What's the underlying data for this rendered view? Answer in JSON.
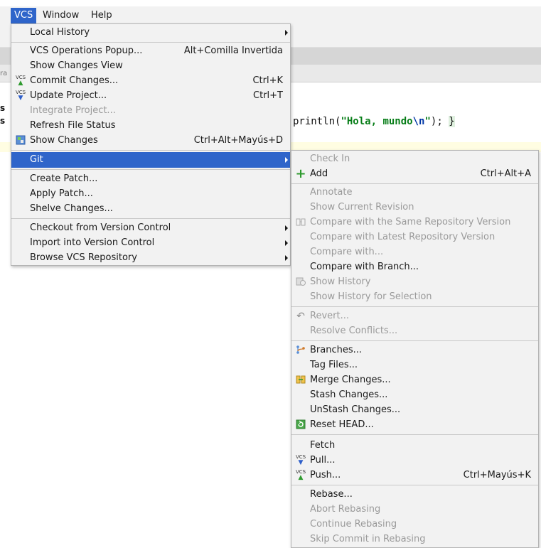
{
  "menubar": {
    "vcs": "VCS",
    "window": "Window",
    "help": "Help"
  },
  "vcs_menu": {
    "local_history": "Local History",
    "vcs_operations_popup": "VCS Operations Popup...",
    "vcs_operations_popup_shortcut": "Alt+Comilla Invertida",
    "show_changes_view": "Show Changes View",
    "commit_changes": "Commit Changes...",
    "commit_changes_shortcut": "Ctrl+K",
    "update_project": "Update Project...",
    "update_project_shortcut": "Ctrl+T",
    "integrate_project": "Integrate Project...",
    "refresh_file_status": "Refresh File Status",
    "show_changes": "Show Changes",
    "show_changes_shortcut": "Ctrl+Alt+Mayús+D",
    "git": "Git",
    "create_patch": "Create Patch...",
    "apply_patch": "Apply Patch...",
    "shelve_changes": "Shelve Changes...",
    "checkout": "Checkout from Version Control",
    "import": "Import into Version Control",
    "browse": "Browse VCS Repository"
  },
  "git_menu": {
    "check_in": "Check In",
    "add": "Add",
    "add_shortcut": "Ctrl+Alt+A",
    "annotate": "Annotate",
    "show_current_revision": "Show Current Revision",
    "compare_same_repo": "Compare with the Same Repository Version",
    "compare_latest_repo": "Compare with Latest Repository Version",
    "compare_with": "Compare with...",
    "compare_with_branch": "Compare with Branch...",
    "show_history": "Show History",
    "show_history_selection": "Show History for Selection",
    "revert": "Revert...",
    "resolve_conflicts": "Resolve Conflicts...",
    "branches": "Branches...",
    "tag_files": "Tag Files...",
    "merge_changes": "Merge Changes...",
    "stash_changes": "Stash Changes...",
    "unstash_changes": "UnStash Changes...",
    "reset_head": "Reset HEAD...",
    "fetch": "Fetch",
    "pull": "Pull...",
    "push": "Push...",
    "push_shortcut": "Ctrl+Mayús+K",
    "rebase": "Rebase...",
    "abort_rebasing": "Abort Rebasing",
    "continue_rebasing": "Continue Rebasing",
    "skip_commit": "Skip Commit in Rebasing"
  },
  "editor": {
    "code_prefix": "println(",
    "code_string_1": "\"Hola",
    "code_comma": ", ",
    "code_string_2": "mundo",
    "code_escape": "\\n",
    "code_string_end": "\"",
    "code_suffix": "); ",
    "code_brace": "}",
    "gutter_s": "s",
    "gutter_ra": "ra"
  },
  "colors": {
    "selection": "#2f65ca",
    "menu_bg": "#f2f2f2",
    "disabled_text": "#9a9a9a"
  }
}
